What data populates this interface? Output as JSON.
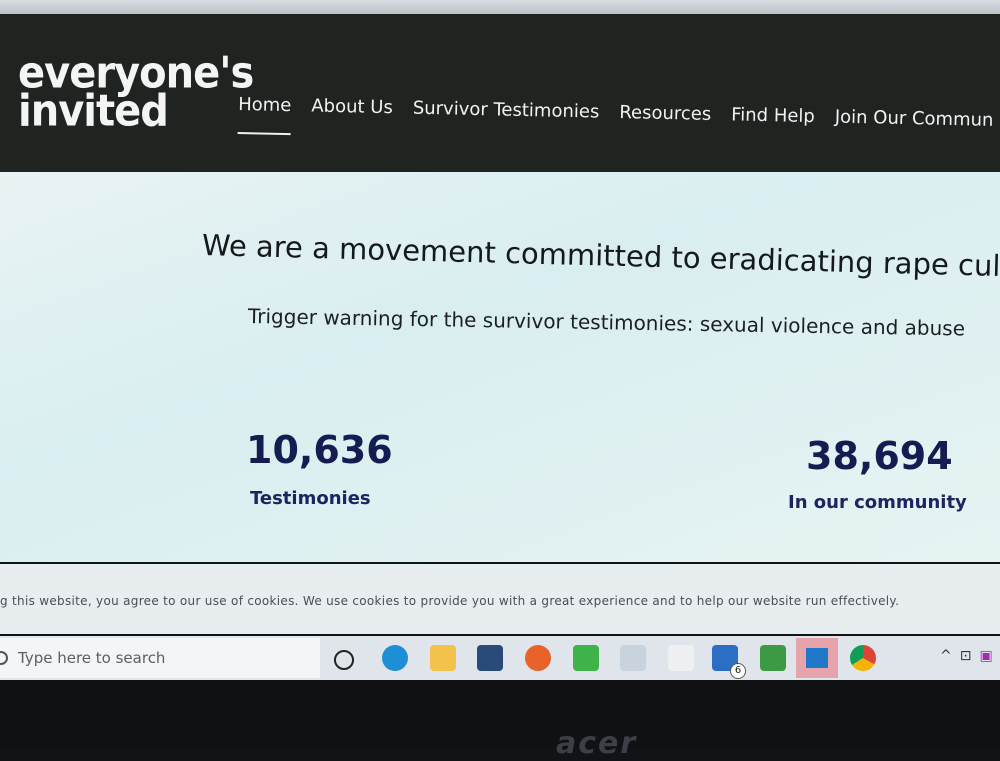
{
  "site": {
    "logo_lines": [
      "everyone's",
      "invited"
    ],
    "nav": [
      {
        "label": "Home",
        "active": true
      },
      {
        "label": "About Us"
      },
      {
        "label": "Survivor Testimonies"
      },
      {
        "label": "Resources"
      },
      {
        "label": "Find Help"
      },
      {
        "label": "Join Our Commun"
      }
    ]
  },
  "hero": {
    "tagline": "We are a movement committed to eradicating rape culture.",
    "trigger": "Trigger warning for the survivor testimonies: sexual violence and abuse",
    "stats": [
      {
        "number": "10,636",
        "label": "Testimonies"
      },
      {
        "number": "38,694",
        "label": "In our community"
      }
    ]
  },
  "cookie_bar": {
    "text": "g this website, you agree to our use of cookies. We use cookies to provide you with a great experience and to help our website run effectively."
  },
  "taskbar": {
    "search_placeholder": "Type here to search",
    "mail_badge": "6",
    "icons": [
      "task-view",
      "edge",
      "file-explorer",
      "store",
      "firefox",
      "app-green",
      "app-doc",
      "app-blank",
      "mail",
      "app-notes",
      "photos",
      "chrome"
    ]
  },
  "device_brand": "acer",
  "colors": {
    "header_bg": "#1f2421",
    "stat_color": "#141c52"
  }
}
